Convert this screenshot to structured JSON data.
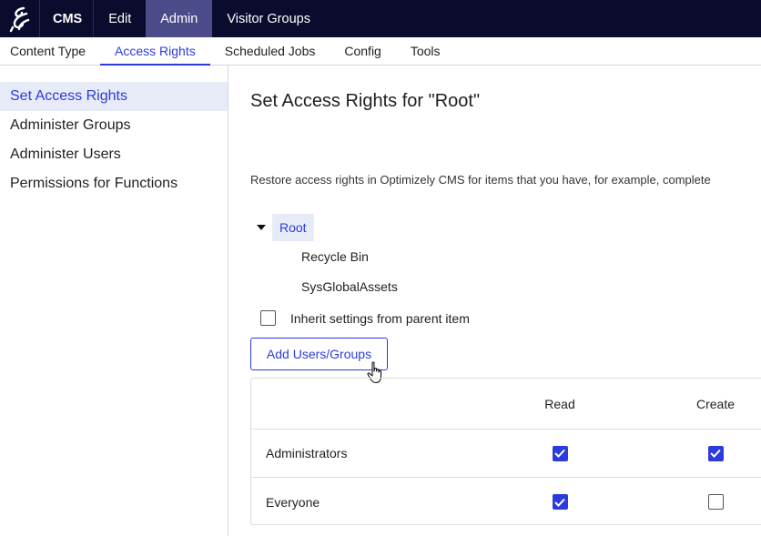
{
  "topbar": {
    "brand": "CMS",
    "items": [
      {
        "label": "Edit",
        "active": false
      },
      {
        "label": "Admin",
        "active": true
      },
      {
        "label": "Visitor Groups",
        "active": false
      }
    ]
  },
  "subnav": {
    "tabs": [
      {
        "label": "Content Type",
        "active": false
      },
      {
        "label": "Access Rights",
        "active": true
      },
      {
        "label": "Scheduled Jobs",
        "active": false
      },
      {
        "label": "Config",
        "active": false
      },
      {
        "label": "Tools",
        "active": false
      }
    ]
  },
  "sidebar": {
    "items": [
      {
        "label": "Set Access Rights",
        "active": true
      },
      {
        "label": "Administer Groups",
        "active": false
      },
      {
        "label": "Administer Users",
        "active": false
      },
      {
        "label": "Permissions for Functions",
        "active": false
      }
    ]
  },
  "main": {
    "title": "Set Access Rights for \"Root\"",
    "description": "Restore access rights in Optimizely CMS for items that you have, for example, complete",
    "tree": {
      "root": "Root",
      "children": [
        "Recycle Bin",
        "SysGlobalAssets"
      ]
    },
    "inherit_label": "Inherit settings from parent item",
    "inherit_checked": false,
    "add_button": "Add Users/Groups",
    "table": {
      "columns": [
        "Read",
        "Create"
      ],
      "rows": [
        {
          "name": "Administrators",
          "read": true,
          "create": true
        },
        {
          "name": "Everyone",
          "read": true,
          "create": false
        }
      ]
    }
  },
  "colors": {
    "topbar_bg": "#0b0b2e",
    "topbar_active": "#4b4b8a",
    "accent": "#2b3bdc",
    "selected_bg": "#e7ebf8"
  },
  "icons": {
    "logo": "optimizely-logo-icon",
    "caret": "caret-down-icon",
    "check": "check-icon",
    "cursor": "hand-pointer-icon"
  }
}
